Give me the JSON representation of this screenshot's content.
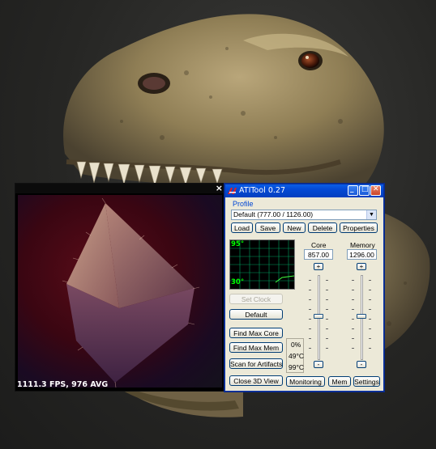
{
  "render_window": {
    "fps_text": "1111.3 FPS, 976 AVG",
    "close_glyph": "×"
  },
  "atitool": {
    "title": "ATITool 0.27",
    "profile_label": "Profile",
    "profile_value": "Default (777.00 / 1126.00)",
    "buttons": {
      "load": "Load",
      "save": "Save",
      "new": "New",
      "delete": "Delete",
      "properties": "Properties",
      "set_clock": "Set Clock",
      "default": "Default",
      "find_max_core": "Find Max Core",
      "find_max_mem": "Find Max Mem",
      "scan_artifacts": "Scan for Artifacts",
      "close_3d_view": "Close 3D View",
      "monitoring": "Monitoring",
      "mem": "Mem",
      "settings": "Settings"
    },
    "graph": {
      "top_label": "95°",
      "bottom_label": "30°"
    },
    "core": {
      "label": "Core",
      "value": "857.00"
    },
    "memory": {
      "label": "Memory",
      "value": "1296.00"
    },
    "status": {
      "percent": "0%",
      "temp1": "49°C",
      "temp2": "99°C"
    },
    "plus": "+",
    "minus": "-"
  }
}
